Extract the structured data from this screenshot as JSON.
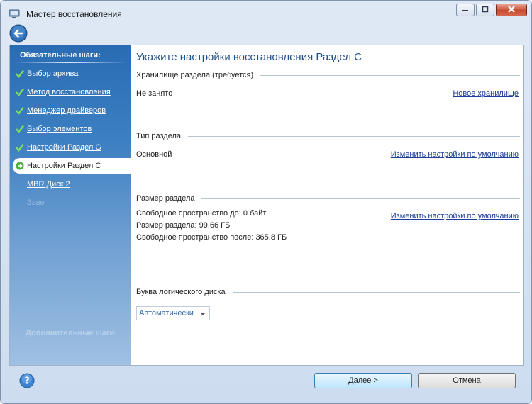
{
  "window": {
    "title": "Мастер восстановления",
    "colors": {
      "sidebar": "#3c7fc2",
      "title_text": "#1f4f8a",
      "link": "#1d3e9a"
    },
    "icons": [
      "app-icon",
      "back-arrow-icon",
      "minimize-icon",
      "maximize-icon",
      "close-icon",
      "help-icon"
    ]
  },
  "sidebar": {
    "heading": "Обязательные шаги:",
    "steps": [
      {
        "label": "Выбор архива",
        "state": "done"
      },
      {
        "label": "Метод восстановления",
        "state": "done"
      },
      {
        "label": "Менеджер драйверов",
        "state": "done"
      },
      {
        "label": "Выбор элементов",
        "state": "done"
      },
      {
        "label": "Настройки Раздел G",
        "state": "done"
      },
      {
        "label": "Настройки Раздел C",
        "state": "current"
      },
      {
        "label": "MBR Диск 2",
        "state": "pending"
      },
      {
        "label": "Заве",
        "state": "disabled"
      }
    ],
    "optional_heading": "Дополнительные шаги"
  },
  "main": {
    "title": "Укажите настройки восстановления Раздел C",
    "storage": {
      "header": "Хранилище раздела (требуется)",
      "value": "Не занято",
      "link": "Новое хранилище"
    },
    "partition_type": {
      "header": "Тип раздела",
      "value": "Основной",
      "link": "Изменить настройки по умолчанию"
    },
    "partition_size": {
      "header": "Размер раздела",
      "free_before": "Свободное пространство до: 0 байт",
      "size": "Размер раздела: 99,66 ГБ",
      "free_after": "Свободное пространство после: 365,8 ГБ",
      "link": "Изменить настройки по умолчанию"
    },
    "drive_letter": {
      "header": "Буква логического диска",
      "selected": "Автоматически"
    }
  },
  "footer": {
    "next_label": "Далее >",
    "cancel_label": "Отмена"
  }
}
